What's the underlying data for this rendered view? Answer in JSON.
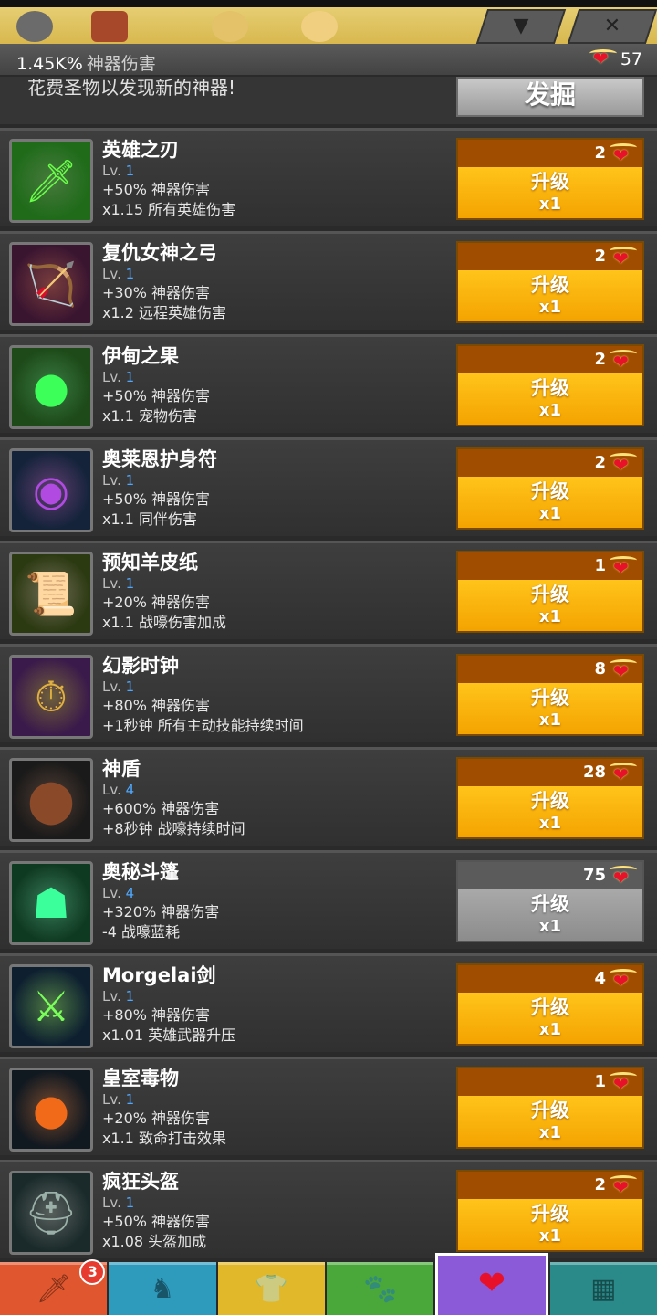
{
  "header": {
    "damage_value": "1.45K%",
    "damage_label": "神器伤害",
    "hearts": "57",
    "description": "花费圣物以发现新的神器!",
    "dig_label": "发掘"
  },
  "top_icons": [
    "gear-icon",
    "crossed-swords-icon",
    "orb-icon",
    "orb-icon",
    "dropdown-tab",
    "close-tab"
  ],
  "artifacts": [
    {
      "name": "英雄之刃",
      "lv_prefix": "Lv.",
      "lv": "1",
      "effect1": "+50% 神器伤害",
      "effect2": "x1.15 所有英雄伤害",
      "cost": "2",
      "button": "升级",
      "mult": "x1",
      "enabled": true,
      "icon": "blade-icon",
      "glyph": "🗡",
      "bg": "#1f6b1a",
      "fg": "#6aff4a"
    },
    {
      "name": "复仇女神之弓",
      "lv_prefix": "Lv.",
      "lv": "1",
      "effect1": "+30% 神器伤害",
      "effect2": "x1.2 远程英雄伤害",
      "cost": "2",
      "button": "升级",
      "mult": "x1",
      "enabled": true,
      "icon": "bow-icon",
      "glyph": "🏹",
      "bg": "#3a1530",
      "fg": "#ff4a4a"
    },
    {
      "name": "伊甸之果",
      "lv_prefix": "Lv.",
      "lv": "1",
      "effect1": "+50% 神器伤害",
      "effect2": "x1.1 宠物伤害",
      "cost": "2",
      "button": "升级",
      "mult": "x1",
      "enabled": true,
      "icon": "fruit-icon",
      "glyph": "●",
      "bg": "#1d4a18",
      "fg": "#3dff5a"
    },
    {
      "name": "奥莱恩护身符",
      "lv_prefix": "Lv.",
      "lv": "1",
      "effect1": "+50% 神器伤害",
      "effect2": "x1.1 同伴伤害",
      "cost": "2",
      "button": "升级",
      "mult": "x1",
      "enabled": true,
      "icon": "amulet-icon",
      "glyph": "◉",
      "bg": "#14233a",
      "fg": "#b04ae0"
    },
    {
      "name": "预知羊皮纸",
      "lv_prefix": "Lv.",
      "lv": "1",
      "effect1": "+20% 神器伤害",
      "effect2": "x1.1 战嚎伤害加成",
      "cost": "1",
      "button": "升级",
      "mult": "x1",
      "enabled": true,
      "icon": "scroll-icon",
      "glyph": "📜",
      "bg": "#2c3a12",
      "fg": "#e8d79a"
    },
    {
      "name": "幻影时钟",
      "lv_prefix": "Lv.",
      "lv": "1",
      "effect1": "+80% 神器伤害",
      "effect2": "+1秒钟 所有主动技能持续时间",
      "cost": "8",
      "button": "升级",
      "mult": "x1",
      "enabled": true,
      "icon": "clock-icon",
      "glyph": "⏱",
      "bg": "#3a1a4a",
      "fg": "#e0b040"
    },
    {
      "name": "神盾",
      "lv_prefix": "Lv.",
      "lv": "4",
      "effect1": "+600% 神器伤害",
      "effect2": "+8秒钟 战嚎持续时间",
      "cost": "28",
      "button": "升级",
      "mult": "x1",
      "enabled": true,
      "icon": "shield-icon",
      "glyph": "⬤",
      "bg": "#1a1a1a",
      "fg": "#8a4a2a"
    },
    {
      "name": "奥秘斗篷",
      "lv_prefix": "Lv.",
      "lv": "4",
      "effect1": "+320% 神器伤害",
      "effect2": "-4 战嚎蓝耗",
      "cost": "75",
      "button": "升级",
      "mult": "x1",
      "enabled": false,
      "icon": "cloak-icon",
      "glyph": "☗",
      "bg": "#0f3a22",
      "fg": "#3aff9a"
    },
    {
      "name": "Morgelai剑",
      "lv_prefix": "Lv.",
      "lv": "1",
      "effect1": "+80% 神器伤害",
      "effect2": "x1.01 英雄武器升压",
      "cost": "4",
      "button": "升级",
      "mult": "x1",
      "enabled": true,
      "icon": "sword-icon",
      "glyph": "⚔",
      "bg": "#0e2030",
      "fg": "#7aff5a"
    },
    {
      "name": "皇室毒物",
      "lv_prefix": "Lv.",
      "lv": "1",
      "effect1": "+20% 神器伤害",
      "effect2": "x1.1 致命打击效果",
      "cost": "1",
      "button": "升级",
      "mult": "x1",
      "enabled": true,
      "icon": "potion-icon",
      "glyph": "●",
      "bg": "#101820",
      "fg": "#f06a1a"
    },
    {
      "name": "疯狂头盔",
      "lv_prefix": "Lv.",
      "lv": "1",
      "effect1": "+50% 神器伤害",
      "effect2": "x1.08 头盔加成",
      "cost": "2",
      "button": "升级",
      "mult": "x1",
      "enabled": true,
      "icon": "helmet-icon",
      "glyph": "⛑",
      "bg": "#1a2a2a",
      "fg": "#9ab0a8"
    }
  ],
  "bottom_nav": [
    {
      "name": "nav-tab-sword",
      "icon": "sword-icon",
      "glyph": "🗡",
      "color": "#e0562e",
      "badge": "3"
    },
    {
      "name": "nav-tab-heroes",
      "icon": "helmet-icon",
      "glyph": "♞",
      "color": "#2e9bbd",
      "badge": ""
    },
    {
      "name": "nav-tab-equipment",
      "icon": "shirt-icon",
      "glyph": "👕",
      "color": "#e0b82a",
      "badge": ""
    },
    {
      "name": "nav-tab-pets",
      "icon": "pet-icon",
      "glyph": "🐾",
      "color": "#4aa83a",
      "badge": ""
    },
    {
      "name": "nav-tab-artifacts",
      "icon": "winged-heart-icon",
      "glyph": "❤",
      "color": "#8a5ad8",
      "badge": "",
      "active": true
    },
    {
      "name": "nav-tab-shop",
      "icon": "chest-icon",
      "glyph": "▦",
      "color": "#2a8a8a",
      "badge": ""
    }
  ]
}
